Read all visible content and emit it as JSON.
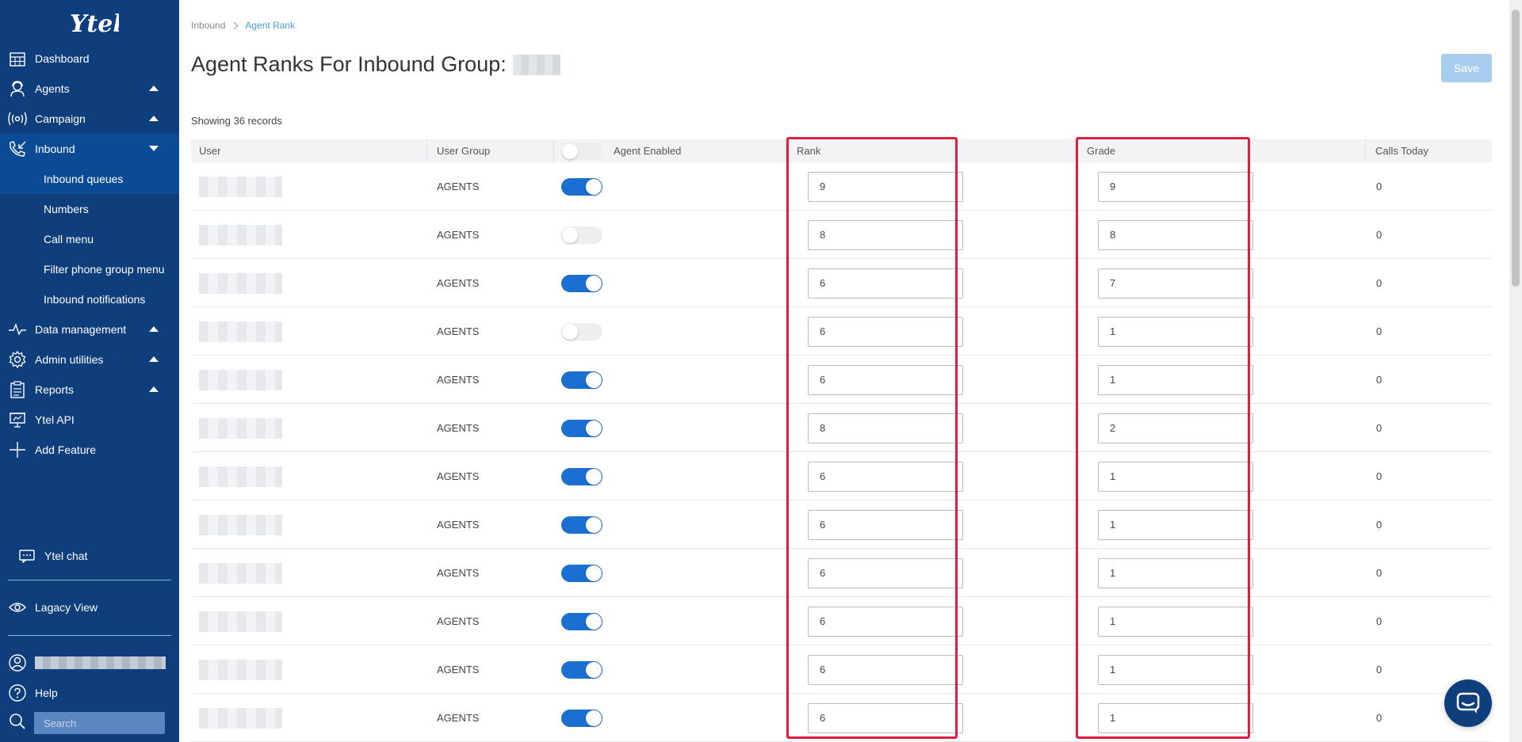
{
  "sidebar": {
    "logo_text": "Ytel",
    "nav": [
      {
        "label": "Dashboard",
        "icon": "calendar-grid-icon",
        "caret": "none"
      },
      {
        "label": "Agents",
        "icon": "agent-headset-icon",
        "caret": "up"
      },
      {
        "label": "Campaign",
        "icon": "broadcast-icon",
        "caret": "up"
      },
      {
        "label": "Inbound",
        "icon": "phone-incoming-icon",
        "caret": "down",
        "active": true
      }
    ],
    "inbound_sub": [
      "Inbound queues",
      "Numbers",
      "Call menu",
      "Filter phone group menu",
      "Inbound notifications"
    ],
    "nav_after": [
      {
        "label": "Data management",
        "icon": "pulse-icon",
        "caret": "up"
      },
      {
        "label": "Admin utilities",
        "icon": "gear-icon",
        "caret": "up"
      },
      {
        "label": "Reports",
        "icon": "clipboard-icon",
        "caret": "up"
      },
      {
        "label": "Ytel API",
        "icon": "presentation-icon",
        "caret": "none"
      },
      {
        "label": "Add Feature",
        "icon": "plus-icon",
        "caret": "none"
      }
    ],
    "chat_label": "Ytel chat",
    "legacy_label": "Lagacy View",
    "help_label": "Help",
    "search_placeholder": "Search"
  },
  "main": {
    "breadcrumb": {
      "parent": "Inbound",
      "current": "Agent Rank"
    },
    "title": "Agent Ranks For Inbound Group:",
    "save_label": "Save",
    "records_text": "Showing 36 records",
    "columns": {
      "user": "User",
      "user_group": "User Group",
      "agent_enabled": "Agent Enabled",
      "rank": "Rank",
      "grade": "Grade",
      "calls_today": "Calls Today"
    },
    "header_toggle_on": false,
    "rows": [
      {
        "group": "AGENTS",
        "enabled": true,
        "rank": "9",
        "grade": "9",
        "calls": "0"
      },
      {
        "group": "AGENTS",
        "enabled": false,
        "rank": "8",
        "grade": "8",
        "calls": "0"
      },
      {
        "group": "AGENTS",
        "enabled": true,
        "rank": "6",
        "grade": "7",
        "calls": "0"
      },
      {
        "group": "AGENTS",
        "enabled": false,
        "rank": "6",
        "grade": "1",
        "calls": "0"
      },
      {
        "group": "AGENTS",
        "enabled": true,
        "rank": "6",
        "grade": "1",
        "calls": "0"
      },
      {
        "group": "AGENTS",
        "enabled": true,
        "rank": "8",
        "grade": "2",
        "calls": "0"
      },
      {
        "group": "AGENTS",
        "enabled": true,
        "rank": "6",
        "grade": "1",
        "calls": "0"
      },
      {
        "group": "AGENTS",
        "enabled": true,
        "rank": "6",
        "grade": "1",
        "calls": "0"
      },
      {
        "group": "AGENTS",
        "enabled": true,
        "rank": "6",
        "grade": "1",
        "calls": "0"
      },
      {
        "group": "AGENTS",
        "enabled": true,
        "rank": "6",
        "grade": "1",
        "calls": "0"
      },
      {
        "group": "AGENTS",
        "enabled": true,
        "rank": "6",
        "grade": "1",
        "calls": "0"
      },
      {
        "group": "AGENTS",
        "enabled": true,
        "rank": "6",
        "grade": "1",
        "calls": "0"
      }
    ]
  },
  "colors": {
    "sidebar": "#0f3e7d",
    "sidebar_active": "#0b4a94",
    "toggle_on": "#1b6fd1",
    "highlight": "#dc1f40",
    "save_disabled": "#a9cdef"
  }
}
